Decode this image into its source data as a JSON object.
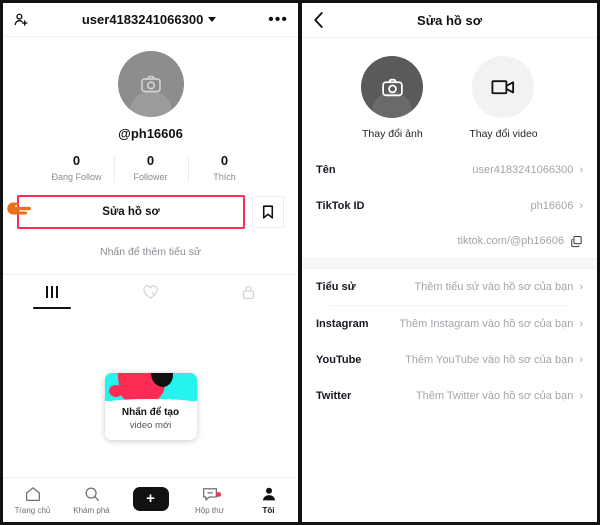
{
  "left": {
    "header": {
      "add_friend_icon": "person-add-icon",
      "username": "user4183241066300",
      "dropdown_icon": "chevron-down-icon",
      "more_icon": "more-options-icon"
    },
    "avatar": {
      "icon": "camera-icon"
    },
    "handle": "@ph16606",
    "stats": [
      {
        "num": "0",
        "label": "Đang Follow"
      },
      {
        "num": "0",
        "label": "Follower"
      },
      {
        "num": "0",
        "label": "Thích"
      }
    ],
    "edit_button": "Sửa hồ sơ",
    "bookmark_icon": "bookmark-icon",
    "pointer_icon": "pointing-hand-icon",
    "bio_hint": "Nhấn để thêm tiểu sử",
    "tabs": [
      {
        "name": "grid",
        "icon": "grid-icon",
        "active": true
      },
      {
        "name": "liked",
        "icon": "heart-slash-icon",
        "active": false
      },
      {
        "name": "private",
        "icon": "lock-icon",
        "active": false
      }
    ],
    "tooltip": {
      "line1": "Nhấn để tạo",
      "line2": "video mới"
    },
    "nav": [
      {
        "label": "Trang chủ",
        "icon": "home-icon",
        "active": false
      },
      {
        "label": "Khám phá",
        "icon": "search-icon",
        "active": false
      },
      {
        "label": "",
        "icon": "create-plus-icon",
        "active": false
      },
      {
        "label": "Hộp thư",
        "icon": "inbox-icon",
        "active": false,
        "badge": true
      },
      {
        "label": "Tôi",
        "icon": "profile-icon",
        "active": true
      }
    ]
  },
  "right": {
    "header": {
      "back_icon": "back-chevron-icon",
      "title": "Sửa hồ sơ"
    },
    "media": [
      {
        "label": "Thay đổi ảnh",
        "icon": "camera-icon"
      },
      {
        "label": "Thay đổi video",
        "icon": "video-camera-icon"
      }
    ],
    "rows": [
      {
        "key": "Tên",
        "value": "user4183241066300",
        "chevron": "›"
      },
      {
        "key": "TikTok ID",
        "value": "ph16606",
        "chevron": "›"
      }
    ],
    "url_row": {
      "value": "tiktok.com/@ph16606",
      "icon": "copy-icon"
    },
    "link_rows": [
      {
        "key": "Tiểu sử",
        "value": "Thêm tiểu sử vào hồ sơ của bạn",
        "chevron": "›"
      },
      {
        "key": "Instagram",
        "value": "Thêm Instagram vào hồ sơ của bạn",
        "chevron": "›"
      },
      {
        "key": "YouTube",
        "value": "Thêm YouTube vào hồ sơ của bạn",
        "chevron": "›"
      },
      {
        "key": "Twitter",
        "value": "Thêm Twitter vào hồ sơ của bạn",
        "chevron": "›"
      }
    ]
  },
  "colors": {
    "accent_red": "#fe2c55",
    "accent_cyan": "#25f4ee",
    "muted": "#a4a5ab",
    "pointer_orange": "#e8721c"
  }
}
